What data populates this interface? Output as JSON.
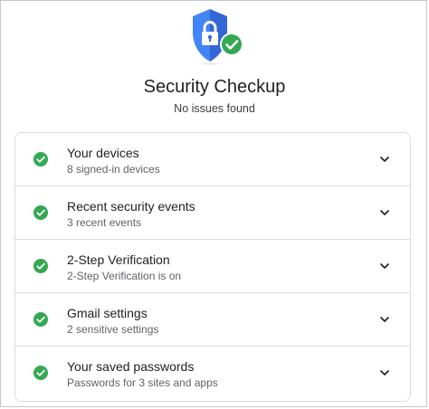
{
  "header": {
    "title": "Security Checkup",
    "subtitle": "No issues found",
    "shield_icon": "shield-lock-check-icon"
  },
  "colors": {
    "shield_blue": "#4285f4",
    "shield_dark_blue": "#3367d6",
    "success_green": "#34a853",
    "check_green": "#34a853",
    "divider": "#dadce0",
    "text_primary": "#202124",
    "text_secondary": "#5f6368"
  },
  "checklist": {
    "items": [
      {
        "title": "Your devices",
        "subtitle": "8 signed-in devices",
        "status_icon": "check-circle-icon",
        "expand_icon": "chevron-down-icon"
      },
      {
        "title": "Recent security events",
        "subtitle": "3 recent events",
        "status_icon": "check-circle-icon",
        "expand_icon": "chevron-down-icon"
      },
      {
        "title": "2-Step Verification",
        "subtitle": "2-Step Verification is on",
        "status_icon": "check-circle-icon",
        "expand_icon": "chevron-down-icon"
      },
      {
        "title": "Gmail settings",
        "subtitle": "2 sensitive settings",
        "status_icon": "check-circle-icon",
        "expand_icon": "chevron-down-icon"
      },
      {
        "title": "Your saved passwords",
        "subtitle": "Passwords for 3 sites and apps",
        "status_icon": "check-circle-icon",
        "expand_icon": "chevron-down-icon"
      }
    ]
  }
}
